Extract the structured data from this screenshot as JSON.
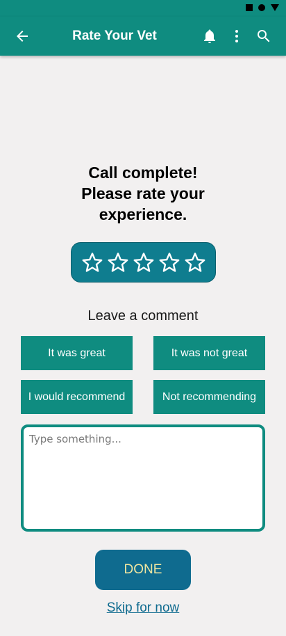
{
  "app_bar": {
    "title": "Rate Your Vet",
    "icons": [
      "arrow-back-icon",
      "bell-icon",
      "more-vertical-icon",
      "search-icon"
    ]
  },
  "headline": {
    "line1": "Call complete!",
    "line2": "Please rate your",
    "line3": "experience."
  },
  "rating": {
    "value": 0,
    "max": 5
  },
  "comment": {
    "label": "Leave a comment",
    "placeholder": "Type something...",
    "value": ""
  },
  "quick_replies": [
    "It was great",
    "It was not great",
    "I would recommend",
    "Not recommending"
  ],
  "actions": {
    "done_label": "DONE",
    "skip_label": "Skip for now"
  },
  "colors": {
    "primary": "#0f8c80",
    "star_box": "#0f7d8f",
    "done_button": "#0f6b8f",
    "done_text": "#f0e6a0",
    "background": "#f2f0f0"
  }
}
